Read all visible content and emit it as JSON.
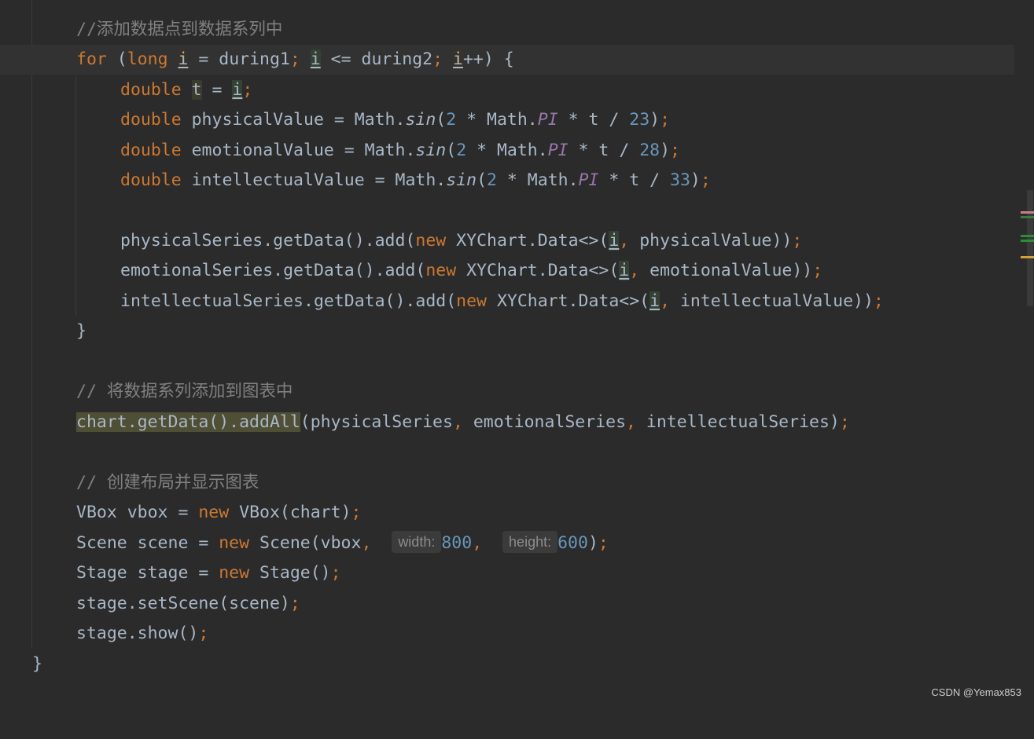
{
  "code": {
    "l1_comment": "//添加数据点到数据系列中",
    "l2": {
      "kw_for": "for",
      "open": " (",
      "kw_long": "long",
      "sp1": " ",
      "i1": "i",
      "mid1": " = during1",
      "semi1": ";",
      "sp2": " ",
      "i2": "i",
      "mid2": " <= during2",
      "semi2": ";",
      "sp3": " ",
      "i3": "i",
      "tail": "++) {"
    },
    "l3": {
      "kw": "double",
      "sp": " ",
      "t": "t",
      "eq": " = ",
      "i": "i",
      "semi": ";"
    },
    "l4": {
      "kw": "double",
      "a": " physicalValue = Math.",
      "sin": "sin",
      "b": "(",
      "n2": "2",
      "c": " * Math.",
      "pi": "PI",
      "d": " * t / ",
      "n": "23",
      "e": ")",
      "semi": ";"
    },
    "l5": {
      "kw": "double",
      "a": " emotionalValue = Math.",
      "sin": "sin",
      "b": "(",
      "n2": "2",
      "c": " * Math.",
      "pi": "PI",
      "d": " * t / ",
      "n": "28",
      "e": ")",
      "semi": ";"
    },
    "l6": {
      "kw": "double",
      "a": " intellectualValue = Math.",
      "sin": "sin",
      "b": "(",
      "n2": "2",
      "c": " * Math.",
      "pi": "PI",
      "d": " * t / ",
      "n": "33",
      "e": ")",
      "semi": ";"
    },
    "l8": {
      "a": "physicalSeries.getData().add(",
      "kw": "new",
      "b": " XYChart.Data<>(",
      "i": "i",
      "comma": ",",
      "c": " physicalValue))",
      "semi": ";"
    },
    "l9": {
      "a": "emotionalSeries.getData().add(",
      "kw": "new",
      "b": " XYChart.Data<>(",
      "i": "i",
      "comma": ",",
      "c": " emotionalValue))",
      "semi": ";"
    },
    "l10": {
      "a": "intellectualSeries.getData().add(",
      "kw": "new",
      "b": " XYChart.Data<>(",
      "i": "i",
      "comma": ",",
      "c": " intellectualValue))",
      "semi": ";"
    },
    "l11": "}",
    "l13_comment": "// 将数据系列添加到图表中",
    "l14": {
      "sel": "chart.getData().addAll",
      "a": "(physicalSeries",
      "c1": ",",
      "b": " emotionalSeries",
      "c2": ",",
      "c": " intellectualSeries)",
      "semi": ";"
    },
    "l16_comment": "// 创建布局并显示图表",
    "l17": {
      "a": "VBox vbox = ",
      "kw": "new",
      "b": " VBox(chart)",
      "semi": ";"
    },
    "l18": {
      "a": "Scene scene = ",
      "kw": "new",
      "b": " Scene(vbox",
      "c1": ",",
      "sp1": " ",
      "hint_w": "width:",
      "n1": "800",
      "c2": ",",
      "sp2": " ",
      "hint_h": "height:",
      "n2": "600",
      "e": ")",
      "semi": ";"
    },
    "l19": {
      "a": "Stage stage = ",
      "kw": "new",
      "b": " Stage()",
      "semi": ";"
    },
    "l20": {
      "a": "stage.setScene(scene)",
      "semi": ";"
    },
    "l21": {
      "a": "stage.show()",
      "semi": ";"
    },
    "l22": "}"
  },
  "icons": {
    "gutter": "lightbulb-icon"
  },
  "watermark": "CSDN @Yemax853",
  "colors": {
    "background": "#2b2b2b",
    "keyword": "#cc7832",
    "number": "#6897bb",
    "comment": "#808080",
    "field": "#9876aa",
    "text": "#a9b7c6"
  }
}
